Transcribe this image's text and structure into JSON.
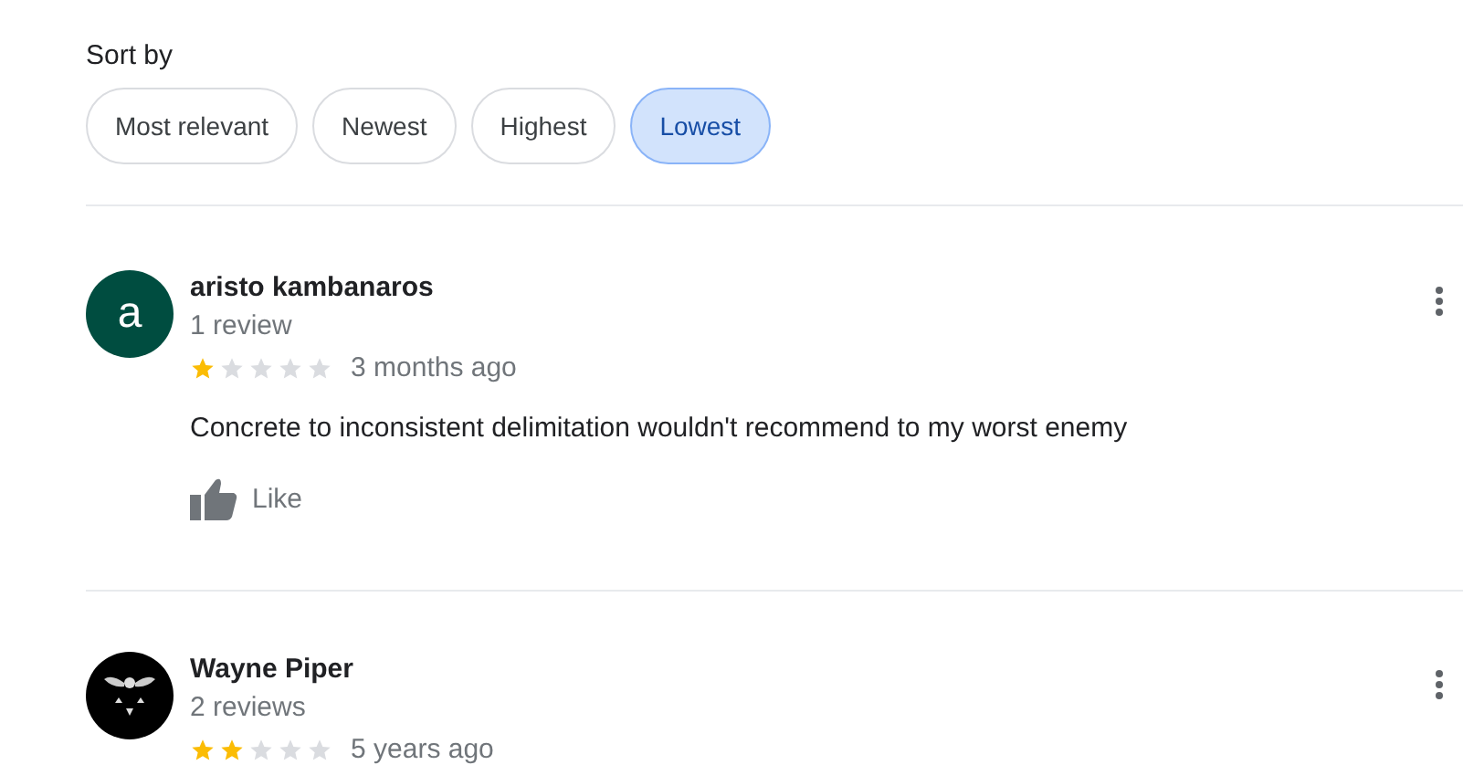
{
  "sort": {
    "label": "Sort by",
    "options": [
      {
        "label": "Most relevant",
        "selected": false
      },
      {
        "label": "Newest",
        "selected": false
      },
      {
        "label": "Highest",
        "selected": false
      },
      {
        "label": "Lowest",
        "selected": true
      }
    ]
  },
  "reviews": [
    {
      "name": "aristo kambanaros",
      "count": "1 review",
      "avatar": {
        "kind": "letter",
        "letter": "a",
        "color": "#004d40"
      },
      "stars": 1,
      "time": "3 months ago",
      "text": "Concrete to inconsistent delimitation wouldn't recommend to my worst enemy",
      "like": "Like"
    },
    {
      "name": "Wayne Piper",
      "count": "2 reviews",
      "avatar": {
        "kind": "image"
      },
      "stars": 2,
      "time": "5 years ago"
    }
  ]
}
